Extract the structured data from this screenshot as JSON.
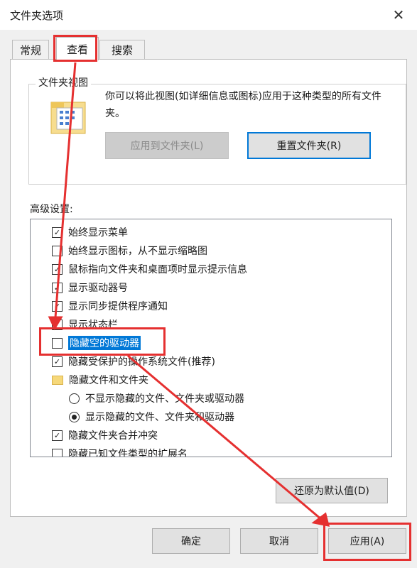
{
  "window": {
    "title": "文件夹选项",
    "close_icon": "close-icon"
  },
  "tabs": [
    {
      "label": "常规",
      "active": false
    },
    {
      "label": "查看",
      "active": true
    },
    {
      "label": "搜索",
      "active": false
    }
  ],
  "folder_views": {
    "group_label": "文件夹视图",
    "description": "你可以将此视图(如详细信息或图标)应用于这种类型的所有文件夹。",
    "apply_button": "应用到文件夹(L)",
    "reset_button": "重置文件夹(R)"
  },
  "advanced": {
    "label": "高级设置:",
    "items": [
      {
        "type": "checkbox",
        "checked": true,
        "label": "始终显示菜单"
      },
      {
        "type": "checkbox",
        "checked": false,
        "label": "始终显示图标，从不显示缩略图"
      },
      {
        "type": "checkbox",
        "checked": true,
        "label": "鼠标指向文件夹和桌面项时显示提示信息"
      },
      {
        "type": "checkbox",
        "checked": true,
        "label": "显示驱动器号"
      },
      {
        "type": "checkbox",
        "checked": true,
        "label": "显示同步提供程序通知"
      },
      {
        "type": "checkbox",
        "checked": true,
        "label": "显示状态栏"
      },
      {
        "type": "checkbox",
        "checked": false,
        "label": "隐藏空的驱动器",
        "selected": true
      },
      {
        "type": "checkbox",
        "checked": true,
        "label": "隐藏受保护的操作系统文件(推荐)"
      },
      {
        "type": "folder",
        "label": "隐藏文件和文件夹"
      },
      {
        "type": "radio",
        "checked": false,
        "label": "不显示隐藏的文件、文件夹或驱动器"
      },
      {
        "type": "radio",
        "checked": true,
        "label": "显示隐藏的文件、文件夹和驱动器"
      },
      {
        "type": "checkbox",
        "checked": true,
        "label": "隐藏文件夹合并冲突"
      },
      {
        "type": "checkbox",
        "checked": false,
        "label": "隐藏已知文件类型的扩展名"
      }
    ],
    "restore_button": "还原为默认值(D)"
  },
  "footer": {
    "ok_button": "确定",
    "cancel_button": "取消",
    "apply_button": "应用(A)"
  },
  "colors": {
    "annotation_red": "#e53030",
    "selection_blue": "#0078d7"
  }
}
